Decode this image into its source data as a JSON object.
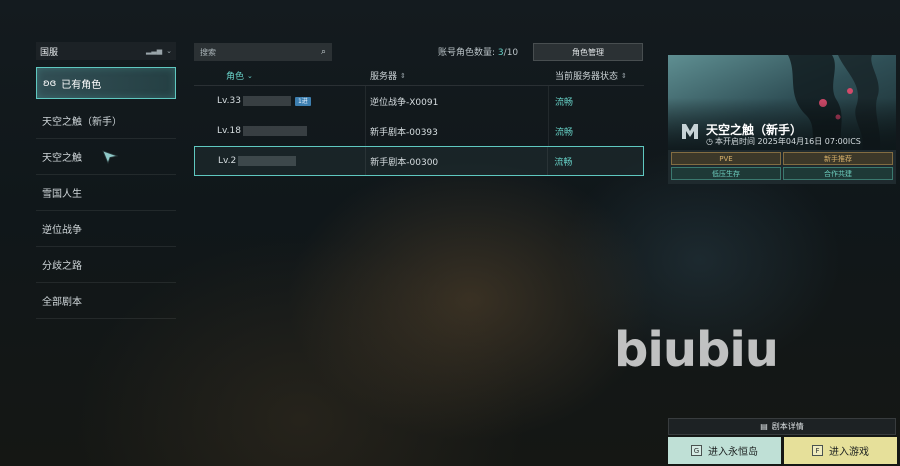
{
  "sidebar": {
    "region": "国服",
    "items": [
      {
        "label": "已有角色",
        "active": true
      },
      {
        "label": "天空之触（新手）"
      },
      {
        "label": "天空之触"
      },
      {
        "label": "雪国人生"
      },
      {
        "label": "逆位战争"
      },
      {
        "label": "分歧之路"
      },
      {
        "label": "全部剧本"
      }
    ]
  },
  "search": {
    "placeholder": "搜索"
  },
  "account": {
    "label": "账号角色数量:",
    "current": "3",
    "max": "/10"
  },
  "manage_button": "角色管理",
  "table": {
    "headers": [
      "角色",
      "服务器",
      "当前服务器状态"
    ],
    "rows": [
      {
        "level": "Lv.33",
        "tag": "1进",
        "server": "逆位战争-X0091",
        "status": "流畅"
      },
      {
        "level": "Lv.18",
        "server": "新手剧本-00393",
        "status": "流畅"
      },
      {
        "level": "Lv.2",
        "server": "新手剧本-00300",
        "status": "流畅",
        "selected": true
      }
    ]
  },
  "card": {
    "title": "天空之触（新手）",
    "subtitle": "本开启时间 2025年04月16日 07:00ICS",
    "tags": [
      "PVE",
      "新手推荐",
      "低压生存",
      "合作共建"
    ]
  },
  "watermark": "biubiu",
  "buttons": {
    "detail": "剧本详情",
    "eternal_key": "G",
    "eternal": "进入永恒岛",
    "enter_key": "F",
    "enter": "进入游戏"
  },
  "colors": {
    "accent": "#5fc8c0",
    "status_ok": "#67d0c6",
    "enter_bg": "#e6e09a",
    "eternal_bg": "#bfe0d6"
  }
}
